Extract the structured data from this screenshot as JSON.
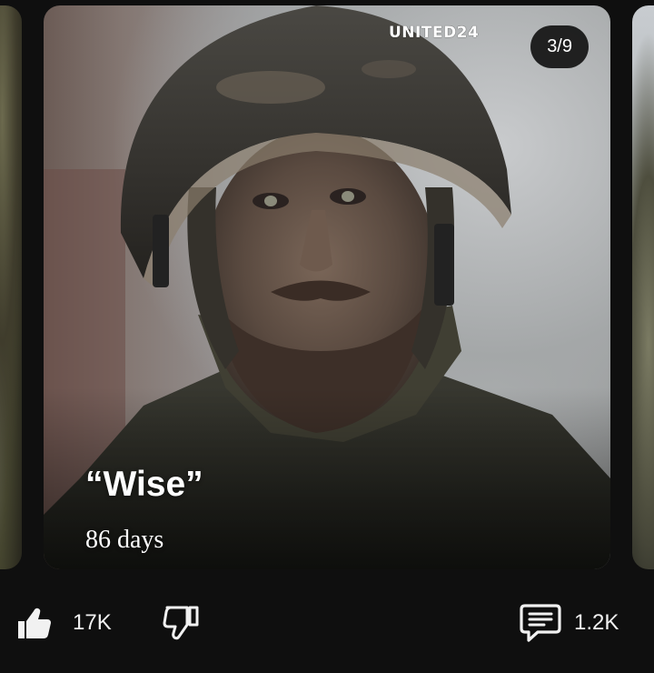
{
  "post": {
    "brand": "UNITED24",
    "page_counter": "3/9",
    "caption_name": "“Wise”",
    "caption_sub": "86 days"
  },
  "actions": {
    "like_count": "17K",
    "comment_count": "1.2K"
  },
  "colors": {
    "background": "#0f0f0f",
    "text": "#f1f1f1",
    "counter_bg": "#0f0f0f"
  },
  "icons": [
    "thumbs-up-icon",
    "thumbs-down-icon",
    "comment-icon"
  ]
}
